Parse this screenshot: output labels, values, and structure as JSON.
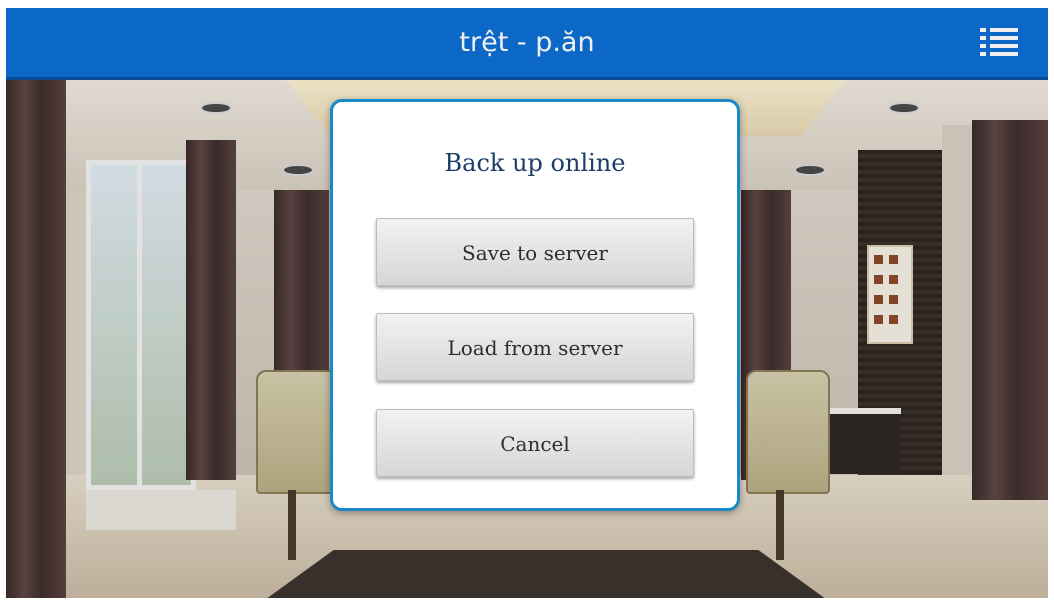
{
  "header": {
    "title": "trệt - p.ăn",
    "menu_icon": "list-menu-icon",
    "background_color": "#0d6fd4"
  },
  "dialog": {
    "title": "Back up online",
    "border_color": "#1b89c7",
    "buttons": [
      {
        "label": "Save to server"
      },
      {
        "label": "Load from server"
      },
      {
        "label": "Cancel"
      }
    ]
  }
}
